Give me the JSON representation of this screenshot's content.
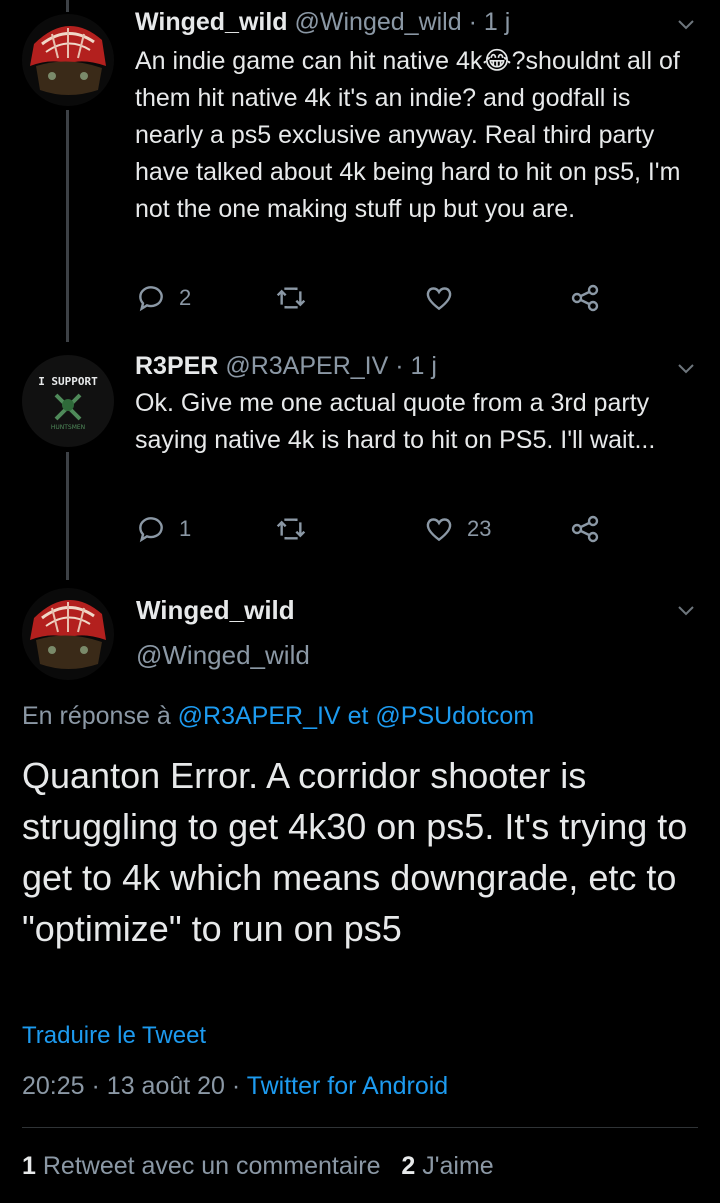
{
  "tweets": [
    {
      "name": "Winged_wild",
      "handle": "@Winged_wild",
      "time": "· 1 j",
      "text": "An indie game can hit native 4k😂?shouldnt all of them hit native 4k it's an indie? and godfall is nearly a ps5  exclusive anyway. Real third party have talked about 4k being hard to hit on ps5, I'm not the one making stuff up but you are.",
      "replies": "2",
      "retweets": "",
      "likes": ""
    },
    {
      "name": "R3PER",
      "handle": "@R3APER_IV",
      "time": "· 1 j",
      "avatar_text": "I SUPPORT",
      "avatar_sub": "HUNTSMEN",
      "text": "Ok. Give me one actual quote from a 3rd party saying native 4k is hard to hit on PS5. I'll wait...",
      "replies": "1",
      "retweets": "",
      "likes": "23"
    }
  ],
  "focus": {
    "name": "Winged_wild",
    "handle": "@Winged_wild",
    "reply_prefix": "En réponse à",
    "reply_to_1": "@R3APER_IV",
    "reply_and": "et",
    "reply_to_2": "@PSUdotcom",
    "text": "Quanton Error. A corridor shooter is struggling to get 4k30 on ps5. It's trying to get to 4k which means downgrade, etc to \"optimize\" to run on ps5",
    "translate": "Traduire le Tweet",
    "time": "20:25",
    "date": "· 13 août 20 ·",
    "source": "Twitter for Android",
    "retweet_count": "1",
    "retweet_label": "Retweet avec un commentaire",
    "like_count": "2",
    "like_label": "J'aime"
  },
  "colors": {
    "accent": "#1d9bf0",
    "muted": "#8b98a5",
    "background": "#000000"
  },
  "icons": [
    "reply-icon",
    "retweet-icon",
    "like-icon",
    "share-icon",
    "chevron-down-icon"
  ]
}
